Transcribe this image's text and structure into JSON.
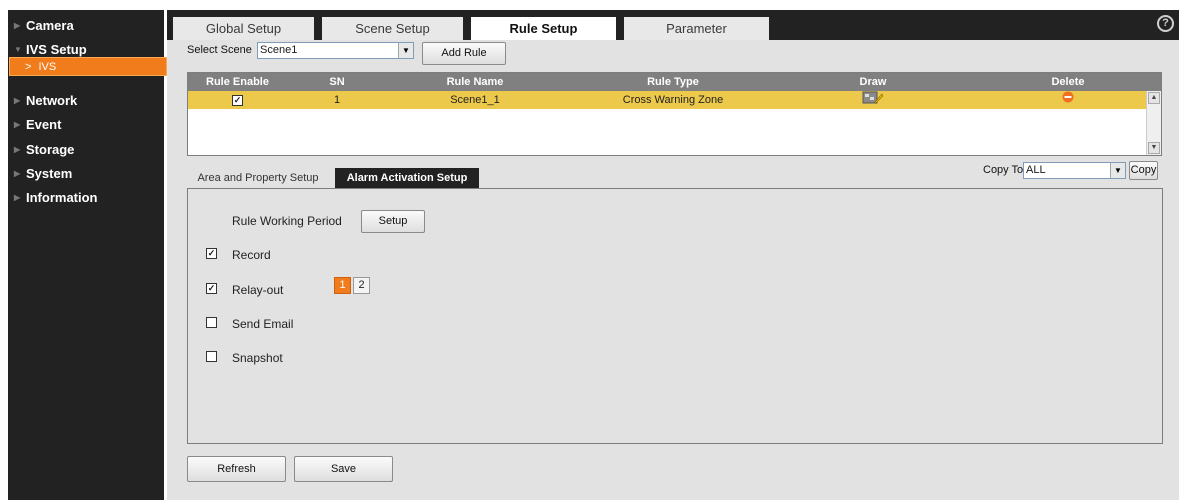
{
  "sidebar": {
    "items": [
      {
        "label": "Camera"
      },
      {
        "label": "IVS Setup"
      },
      {
        "label": "Network"
      },
      {
        "label": "Event"
      },
      {
        "label": "Storage"
      },
      {
        "label": "System"
      },
      {
        "label": "Information"
      }
    ],
    "sub_item": "IVS"
  },
  "tabs": [
    "Global Setup",
    "Scene Setup",
    "Rule Setup",
    "Parameter"
  ],
  "active_tab": "Rule Setup",
  "help_symbol": "?",
  "scene": {
    "label": "Select Scene",
    "value": "Scene1",
    "add_rule": "Add Rule"
  },
  "rules_table": {
    "headers": [
      "Rule Enable",
      "SN",
      "Rule Name",
      "Rule Type",
      "Draw",
      "Delete"
    ],
    "rows": [
      {
        "enabled": "✓",
        "sn": "1",
        "name": "Scene1_1",
        "type": "Cross Warning Zone",
        "draw_icon": "draw-zone-icon",
        "delete_icon": "delete-icon"
      }
    ]
  },
  "sub_tabs": [
    "Area and Property Setup",
    "Alarm Activation Setup"
  ],
  "active_sub_tab": "Alarm Activation Setup",
  "copy": {
    "label": "Copy To",
    "value": "ALL",
    "button": "Copy"
  },
  "alarm": {
    "working_period_label": "Rule Working Period",
    "setup_button": "Setup",
    "options": [
      {
        "label": "Record",
        "checked": true
      },
      {
        "label": "Relay-out",
        "checked": true
      },
      {
        "label": "Send Email",
        "checked": false
      },
      {
        "label": "Snapshot",
        "checked": false
      }
    ],
    "relay_channels": [
      {
        "label": "1",
        "active": true
      },
      {
        "label": "2",
        "active": false
      }
    ]
  },
  "footer": {
    "refresh": "Refresh",
    "save": "Save"
  },
  "colors": {
    "accent": "#f07c1b",
    "row_highlight": "#ecc94a",
    "sidebar_bg": "#222222",
    "panel_bg": "#e2e2e2"
  }
}
